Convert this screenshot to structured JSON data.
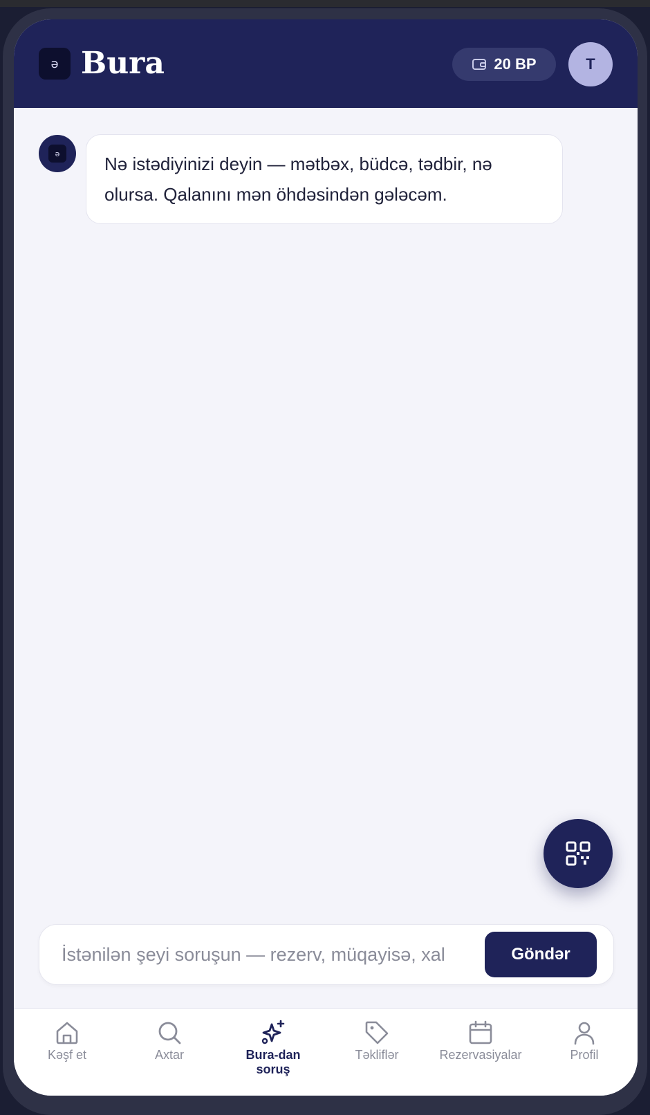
{
  "header": {
    "logo_glyph": "ə",
    "brand": "Bura",
    "points": "20 BP",
    "avatar_initial": "T"
  },
  "chat": {
    "bot_glyph": "ə",
    "messages": [
      {
        "from": "bot",
        "text": "Nə istədiyinizi deyin — mətbəx, büdcə, tədbir, nə olursa. Qalanını mən öhdəsindən gələcəm."
      }
    ]
  },
  "fab": {
    "icon": "qr-code-icon"
  },
  "composer": {
    "placeholder": "İstənilən şeyi soruşun — rezerv, müqayisə, xal",
    "value": "",
    "send_label": "Göndər"
  },
  "nav": {
    "items": [
      {
        "label": "Kəşf et",
        "icon": "home-icon",
        "active": false
      },
      {
        "label": "Axtar",
        "icon": "search-icon",
        "active": false
      },
      {
        "label": "Bura-dan soruş",
        "icon": "sparkles-icon",
        "active": true
      },
      {
        "label": "Təkliflər",
        "icon": "tag-icon",
        "active": false
      },
      {
        "label": "Rezervasiyalar",
        "icon": "calendar-icon",
        "active": false
      },
      {
        "label": "Profil",
        "icon": "user-icon",
        "active": false
      }
    ]
  },
  "colors": {
    "brand_navy": "#1f2359",
    "background": "#f4f4fa",
    "muted_text": "#8a8c99",
    "avatar_lavender": "#b3b4e2"
  }
}
